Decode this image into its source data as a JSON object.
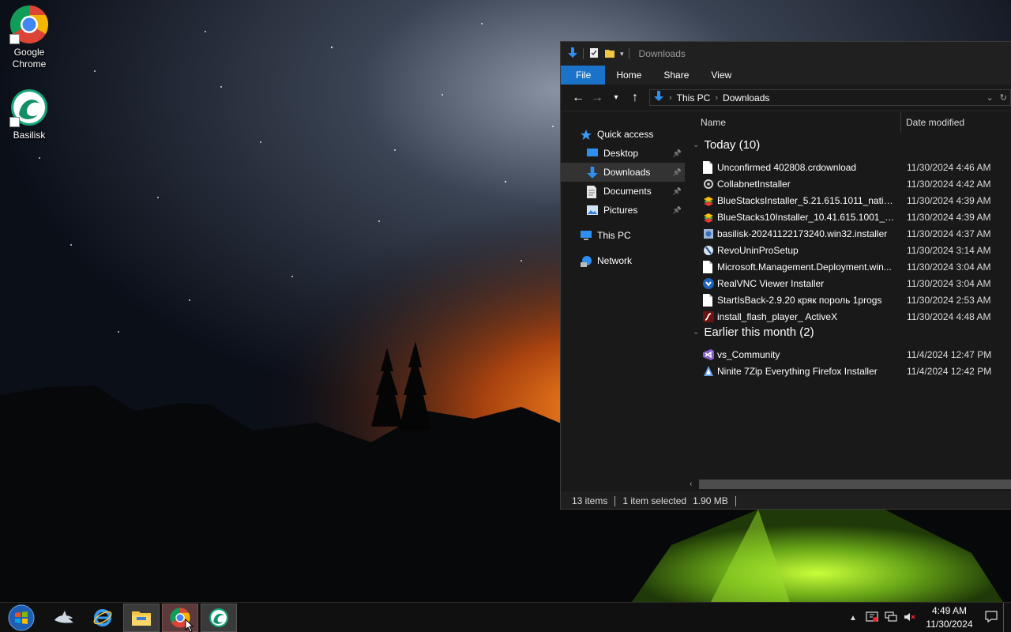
{
  "desktop": {
    "icons": [
      {
        "label": "Google\nChrome",
        "line1": "Google",
        "line2": "Chrome",
        "icon": "chrome-icon"
      },
      {
        "label": "Basilisk",
        "line1": "Basilisk",
        "icon": "basilisk-icon"
      }
    ]
  },
  "explorer": {
    "title": "Downloads",
    "ribbon_tabs": [
      "File",
      "Home",
      "Share",
      "View"
    ],
    "address": {
      "segments": [
        "This PC",
        "Downloads"
      ]
    },
    "nav": {
      "quick_access": "Quick access",
      "items": [
        {
          "label": "Desktop",
          "pinned": true
        },
        {
          "label": "Downloads",
          "pinned": true,
          "selected": true
        },
        {
          "label": "Documents",
          "pinned": true
        },
        {
          "label": "Pictures",
          "pinned": true
        }
      ],
      "this_pc": "This PC",
      "network": "Network"
    },
    "columns": {
      "name": "Name",
      "date": "Date modified"
    },
    "groups": [
      {
        "header": "Today (10)",
        "files": [
          {
            "name": "Unconfirmed 402808.crdownload",
            "date": "11/30/2024 4:46 AM",
            "icon": "blank-file-icon"
          },
          {
            "name": "CollabnetInstaller",
            "date": "11/30/2024 4:42 AM",
            "icon": "installer-icon"
          },
          {
            "name": "BlueStacksInstaller_5.21.615.1011_native_...",
            "date": "11/30/2024 4:39 AM",
            "icon": "bluestacks-icon"
          },
          {
            "name": "BlueStacks10Installer_10.41.615.1001_nati...",
            "date": "11/30/2024 4:39 AM",
            "icon": "bluestacks-icon"
          },
          {
            "name": "basilisk-20241122173240.win32.installer",
            "date": "11/30/2024 4:37 AM",
            "icon": "setup-icon"
          },
          {
            "name": "RevoUninProSetup",
            "date": "11/30/2024 3:14 AM",
            "icon": "revo-icon"
          },
          {
            "name": "Microsoft.Management.Deployment.win...",
            "date": "11/30/2024 3:04 AM",
            "icon": "blank-file-icon"
          },
          {
            "name": "RealVNC Viewer Installer",
            "date": "11/30/2024 3:04 AM",
            "icon": "realvnc-icon"
          },
          {
            "name": "StartIsBack-2.9.20 кряк пороль 1progs",
            "date": "11/30/2024 2:53 AM",
            "icon": "blank-file-icon"
          },
          {
            "name": "install_flash_player_ ActiveX",
            "date": "11/30/2024 4:48 AM",
            "icon": "flash-icon"
          }
        ]
      },
      {
        "header": "Earlier this month (2)",
        "files": [
          {
            "name": "vs_Community",
            "date": "11/4/2024 12:47 PM",
            "icon": "visual-studio-icon"
          },
          {
            "name": "Ninite 7Zip Everything Firefox Installer",
            "date": "11/4/2024 12:42 PM",
            "icon": "ninite-icon"
          }
        ]
      }
    ],
    "status": {
      "items": "13 items",
      "selected": "1 item selected",
      "size": "1.90 MB"
    }
  },
  "taskbar": {
    "clock_time": "4:49 AM",
    "clock_date": "11/30/2024"
  },
  "colors": {
    "accent": "#1a73c8",
    "window_bg": "#191919",
    "taskbar_bg": "#101010"
  }
}
